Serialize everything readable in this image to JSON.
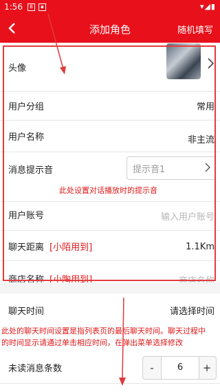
{
  "status_bar": {
    "time": "1:56",
    "icon_a": "B",
    "icon_b": "▪",
    "right_icons": "▾◢▮"
  },
  "app_bar": {
    "title": "添加角色",
    "action": "随机填写"
  },
  "rows": {
    "avatar": {
      "label": "头像"
    },
    "group": {
      "label": "用户分组",
      "value": "常用"
    },
    "name": {
      "label": "用户名称",
      "value": "非主流"
    },
    "notice": {
      "label": "消息提示音",
      "value": "提示音1",
      "note": "此处设置对话播放时的提示音"
    },
    "account": {
      "label": "用户账号",
      "placeholder": "输入用户账号"
    },
    "distance": {
      "label": "聊天距离",
      "tag": "[小陌用到]",
      "value": "1.1Km"
    },
    "shop": {
      "label": "商店名称",
      "tag": "[小陶用到]",
      "placeholder": "商店名称"
    },
    "chat_time": {
      "label": "聊天时间",
      "value": "请选择时间",
      "note_line1": "此处的聊天时间设置是指列表页的最后聊天时间。聊天过程中",
      "note_line2": "的时间显示请通过单击相应时间，在弹出菜单选择修改"
    },
    "unread": {
      "label": "未读消息条数",
      "minus": "-",
      "value": "6",
      "plus": "+"
    }
  },
  "colors": {
    "primary": "#e8101b",
    "note_red": "#e01818"
  }
}
